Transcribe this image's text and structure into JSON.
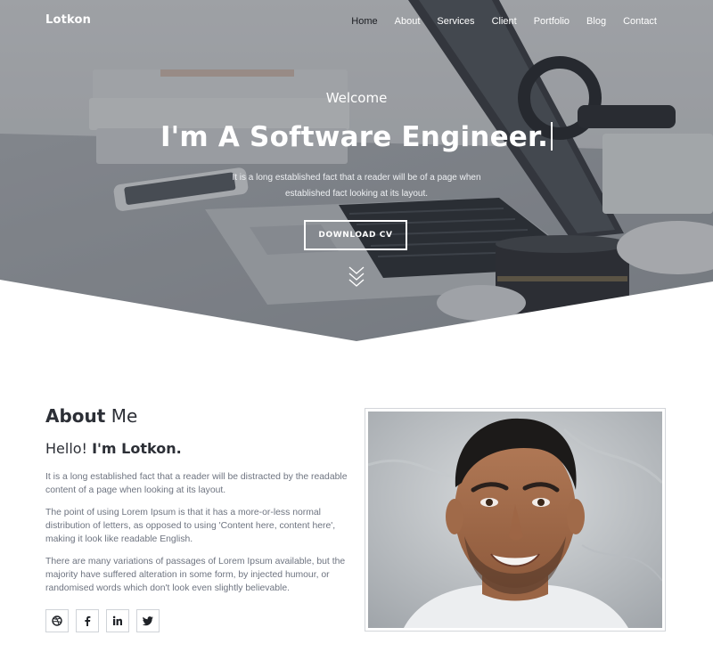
{
  "nav": {
    "logo": "Lotkon",
    "items": [
      {
        "label": "Home",
        "active": true
      },
      {
        "label": "About",
        "active": false
      },
      {
        "label": "Services",
        "active": false
      },
      {
        "label": "Client",
        "active": false
      },
      {
        "label": "Portfolio",
        "active": false
      },
      {
        "label": "Blog",
        "active": false
      },
      {
        "label": "Contact",
        "active": false
      }
    ]
  },
  "hero": {
    "welcome": "Welcome",
    "headline": "I'm A Software Engineer.",
    "tagline": "It is a long established fact that a reader will be of a page when established fact looking at its layout.",
    "cta": "DOWNLOAD CV",
    "scroll_icon": "chevrons-down-icon"
  },
  "about": {
    "title_bold": "About",
    "title_rest": " Me",
    "hello_prefix": "Hello! ",
    "hello_name": "I'm Lotkon.",
    "paragraphs": [
      "It is a long established fact that a reader will be distracted by the readable content of a page when looking at its layout.",
      "The point of using Lorem Ipsum is that it has a more-or-less normal distribution of letters, as opposed to using 'Content here, content here', making it look like readable English.",
      "There are many variations of passages of Lorem Ipsum available, but the majority have suffered alteration in some form, by injected humour, or randomised words which don't look even slightly believable."
    ],
    "socials": [
      {
        "icon": "dribbble-icon",
        "glyph": "◎"
      },
      {
        "icon": "facebook-icon",
        "glyph": "f"
      },
      {
        "icon": "linkedin-icon",
        "glyph": "in"
      },
      {
        "icon": "twitter-icon",
        "glyph": "🐦"
      }
    ]
  },
  "colors": {
    "text_dark": "#2c2f36",
    "text_muted": "#6e7480",
    "white": "#ffffff"
  }
}
